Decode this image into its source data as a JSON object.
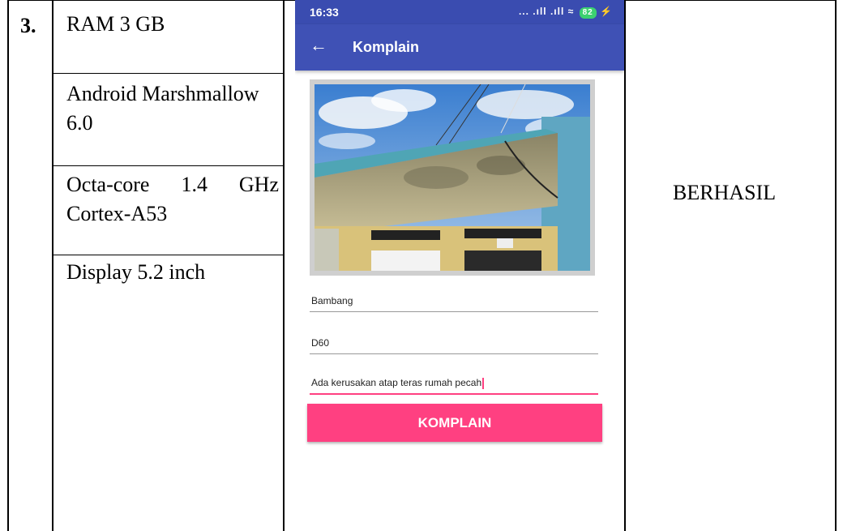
{
  "row": {
    "number": "3.",
    "specs": [
      "RAM 3 GB",
      "Android Marshmallow 6.0",
      "Octa-core 1.4 GHz Cortex-A53",
      "Display 5.2 inch"
    ],
    "result": "BERHASIL"
  },
  "phone": {
    "status_time": "16:33",
    "status_icons": "... .ıll .ıll ≈",
    "battery": "82",
    "appbar_title": "Komplain",
    "fields": {
      "name": "Bambang",
      "block": "D60",
      "complaint": "Ada kerusakan atap teras rumah pecah"
    },
    "submit_label": "KOMPLAIN"
  },
  "colors": {
    "primary": "#3f51b5",
    "accent": "#ff4081"
  }
}
